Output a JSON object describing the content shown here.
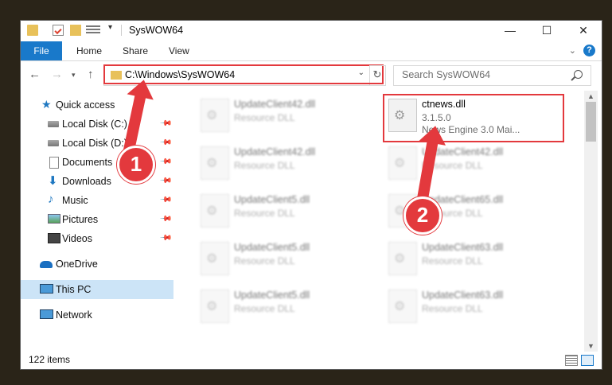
{
  "window": {
    "title": "SysWOW64",
    "controls": {
      "minimize": "—",
      "maximize": "☐",
      "close": "✕"
    }
  },
  "ribbon": {
    "file": "File",
    "tabs": [
      "Home",
      "Share",
      "View"
    ],
    "help": "?"
  },
  "nav": {
    "address": "C:\\Windows\\SysWOW64",
    "search_placeholder": "Search SysWOW64"
  },
  "sidebar": {
    "items": [
      {
        "label": "Quick access",
        "icon": "star-icon"
      },
      {
        "label": "Local Disk (C:)",
        "icon": "disk-icon",
        "pinned": true
      },
      {
        "label": "Local Disk (D:)",
        "icon": "disk-icon",
        "pinned": true
      },
      {
        "label": "Documents",
        "icon": "documents-icon",
        "pinned": true
      },
      {
        "label": "Downloads",
        "icon": "downloads-icon",
        "pinned": true
      },
      {
        "label": "Music",
        "icon": "music-icon",
        "pinned": true
      },
      {
        "label": "Pictures",
        "icon": "pictures-icon",
        "pinned": true
      },
      {
        "label": "Videos",
        "icon": "videos-icon",
        "pinned": true
      },
      {
        "label": "OneDrive",
        "icon": "cloud-icon"
      },
      {
        "label": "This PC",
        "icon": "computer-icon",
        "selected": true
      },
      {
        "label": "Network",
        "icon": "network-icon"
      }
    ]
  },
  "files": {
    "highlighted": {
      "name": "ctnews.dll",
      "version": "3.1.5.0",
      "description": "News Engine 3.0 Mai..."
    },
    "left_column": [
      {
        "name": "UpdateClient42.dll",
        "type": "Resource DLL"
      },
      {
        "name": "UpdateClient42.dll",
        "type": "Resource DLL"
      },
      {
        "name": "UpdateClient5.dll",
        "type": "Resource DLL"
      },
      {
        "name": "UpdateClient5.dll",
        "type": "Resource DLL"
      },
      {
        "name": "UpdateClient5.dll",
        "type": "Resource DLL"
      }
    ],
    "right_column": [
      {
        "name": "UpdateClient42.dll",
        "type": "Resource DLL"
      },
      {
        "name": "UpdateClient65.dll",
        "type": "Resource DLL"
      },
      {
        "name": "UpdateClient63.dll",
        "type": "Resource DLL"
      },
      {
        "name": "UpdateClient63.dll",
        "type": "Resource DLL"
      }
    ]
  },
  "status": {
    "items": "122 items"
  },
  "annotations": {
    "step1": "1",
    "step2": "2",
    "color": "#e3393d"
  }
}
